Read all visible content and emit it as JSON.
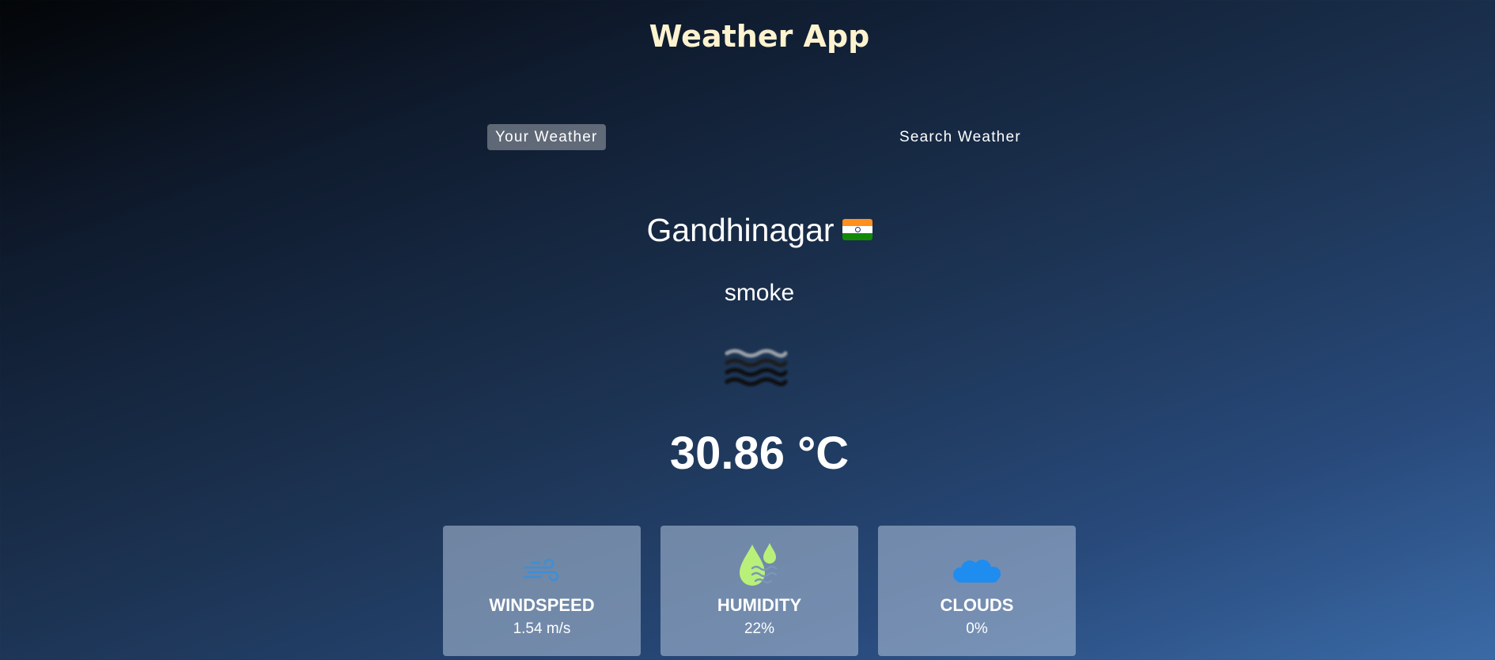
{
  "app": {
    "title": "Weather App"
  },
  "tabs": [
    {
      "label": "Your Weather",
      "active": true
    },
    {
      "label": "Search Weather",
      "active": false
    }
  ],
  "weather": {
    "city": "Gandhinagar",
    "country_flag_icon": "india-flag-icon",
    "description": "smoke",
    "icon": "smoke-haze-icon",
    "temperature": "30.86 °C"
  },
  "stats": [
    {
      "label": "WINDSPEED",
      "value": "1.54 m/s",
      "icon": "wind-icon",
      "icon_color": "#3d8fd6"
    },
    {
      "label": "HUMIDITY",
      "value": "22%",
      "icon": "humidity-drops-icon",
      "icon_color": "#b8f07a"
    },
    {
      "label": "CLOUDS",
      "value": "0%",
      "icon": "cloud-icon",
      "icon_color": "#1f8cf0"
    }
  ],
  "colors": {
    "title": "#fdf3cf",
    "active_tab_bg": "rgba(255,255,255,0.33)",
    "card_bg": "rgba(178,196,220,0.55)"
  }
}
